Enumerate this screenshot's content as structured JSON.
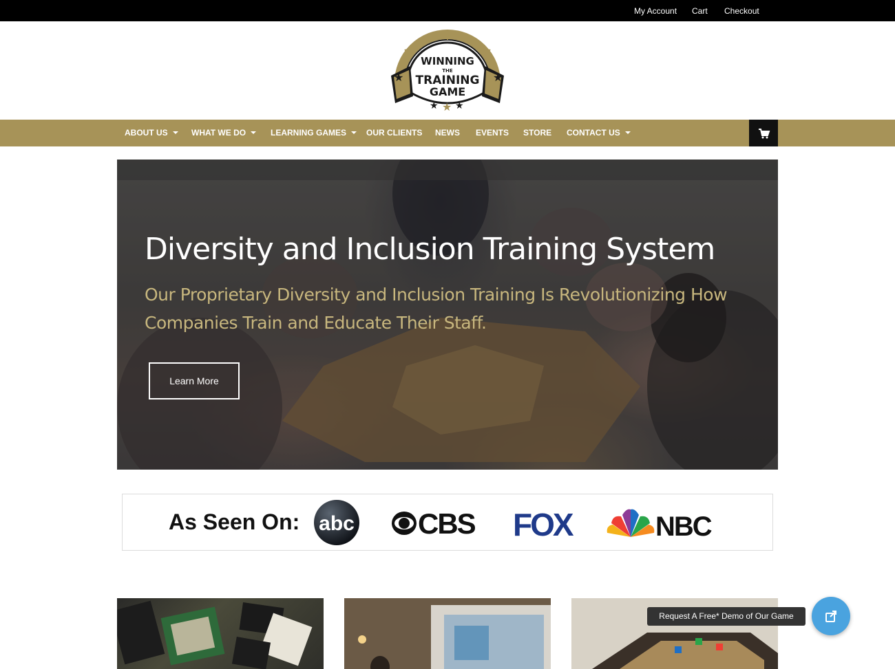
{
  "topbar": {
    "links": [
      {
        "label": "My Account"
      },
      {
        "label": "Cart"
      },
      {
        "label": "Checkout"
      }
    ]
  },
  "logo": {
    "lines": [
      "WINNING",
      "THE",
      "TRAINING",
      "GAME"
    ],
    "colors": {
      "gold": "#a79358",
      "dark": "#1a1a1a"
    }
  },
  "nav": {
    "items": [
      {
        "label": "ABOUT US",
        "dropdown": true
      },
      {
        "label": "WHAT WE DO",
        "dropdown": true
      },
      {
        "label": "LEARNING GAMES",
        "dropdown": true
      },
      {
        "label": "OUR CLIENTS",
        "dropdown": false
      },
      {
        "label": "NEWS",
        "dropdown": false
      },
      {
        "label": "EVENTS",
        "dropdown": false
      },
      {
        "label": "STORE",
        "dropdown": false
      },
      {
        "label": "CONTACT US",
        "dropdown": true
      }
    ],
    "cart_icon": "shopping-cart-icon",
    "background": "#a79358"
  },
  "hero": {
    "title": "Diversity and Inclusion Training System",
    "subtitle": "Our Proprietary Diversity and Inclusion Training Is Revolutionizing How Companies Train and Educate Their Staff.",
    "button_label": "Learn More",
    "subtitle_color": "#c8b77e"
  },
  "as_seen_on": {
    "label": "As Seen On:",
    "networks": [
      {
        "name": "abc",
        "icon": "abc-logo"
      },
      {
        "name": "CBS",
        "icon": "cbs-logo"
      },
      {
        "name": "FOX",
        "icon": "fox-logo"
      },
      {
        "name": "NBC",
        "icon": "nbc-logo"
      }
    ]
  },
  "demo": {
    "tooltip": "Request A Free* Demo of Our Game",
    "icon": "external-link-icon",
    "color": "#4aa3df"
  }
}
